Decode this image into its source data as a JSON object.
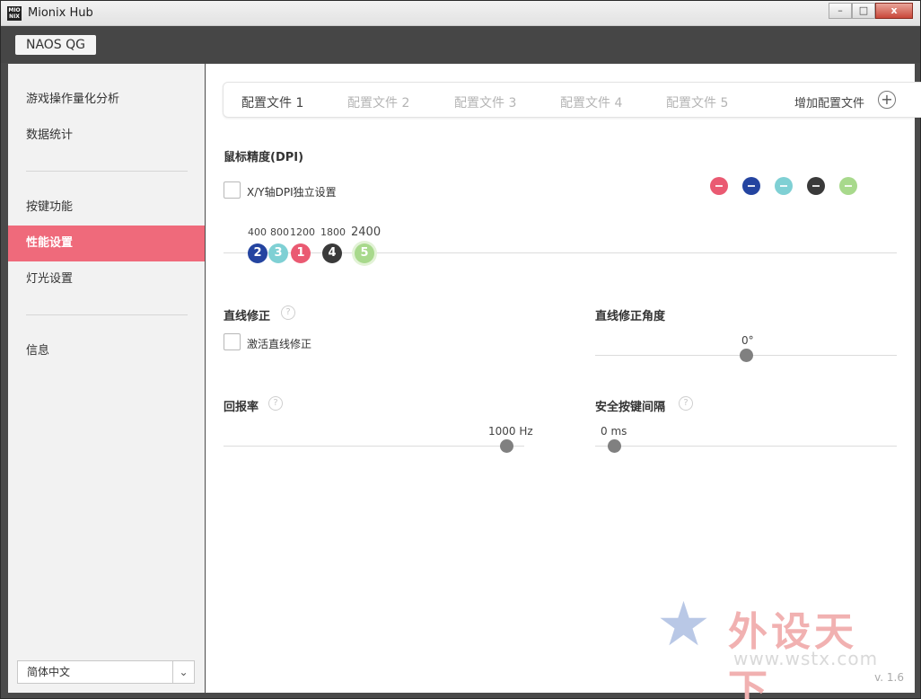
{
  "app": {
    "title": "Mionix Hub",
    "logo_text": "MIO NIX"
  },
  "window_controls": {
    "minimize": "–",
    "maximize": "□",
    "close": "x"
  },
  "device": {
    "name": "NAOS QG"
  },
  "sidebar": {
    "items": [
      {
        "label": "游戏操作量化分析"
      },
      {
        "label": "数据统计"
      },
      {
        "label": "按键功能"
      },
      {
        "label": "性能设置",
        "active": true
      },
      {
        "label": "灯光设置"
      },
      {
        "label": "信息"
      }
    ],
    "language": "简体中文"
  },
  "profiles": {
    "tabs": [
      "配置文件 1",
      "配置文件 2",
      "配置文件 3",
      "配置文件 4",
      "配置文件 5"
    ],
    "active_index": 0,
    "add_label": "增加配置文件"
  },
  "dpi": {
    "title": "鼠标精度(DPI)",
    "xy_checkbox_label": "X/Y轴DPI独立设置",
    "xy_checked": false,
    "swatch_colors": [
      "#ea5a72",
      "#2444a0",
      "#7fd0d4",
      "#3a3a3a",
      "#a8d98c"
    ],
    "level_labels": [
      "400",
      "800",
      "1200",
      "1800",
      "2400"
    ],
    "nodes": [
      {
        "num": "2",
        "color": "#2444a0"
      },
      {
        "num": "3",
        "color": "#7fd0d4"
      },
      {
        "num": "1",
        "color": "#ea5a72"
      },
      {
        "num": "4",
        "color": "#3a3a3a"
      },
      {
        "num": "5",
        "color": "#a8d98c"
      }
    ]
  },
  "angle_snapping": {
    "title": "直线修正",
    "help": "?",
    "checkbox_label": "激活直线修正",
    "checked": false
  },
  "angle_snapping_angle": {
    "title": "直线修正角度",
    "value": "0°"
  },
  "polling_rate": {
    "title": "回报率",
    "help": "?",
    "value": "1000 Hz"
  },
  "debounce": {
    "title": "安全按键间隔",
    "help": "?",
    "value": "0 ms"
  },
  "watermark": {
    "text": "外设天下",
    "url": "www.wstx.com"
  },
  "version": "v. 1.6"
}
